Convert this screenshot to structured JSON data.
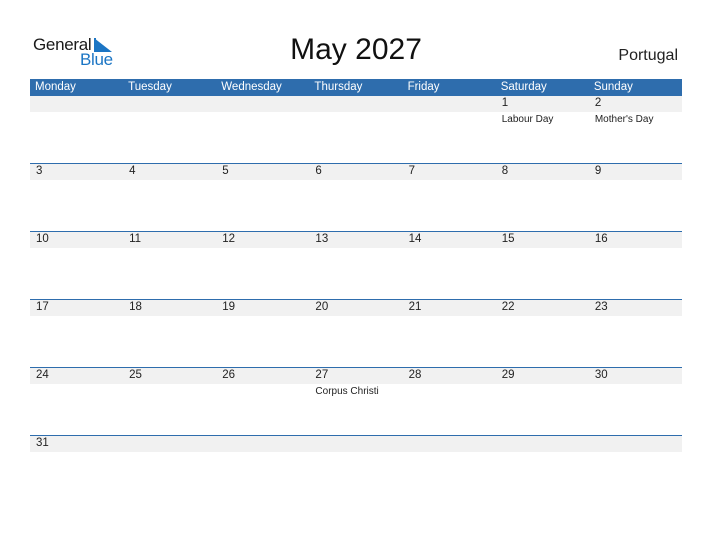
{
  "logo": {
    "line1": "General",
    "line2": "Blue"
  },
  "title": "May 2027",
  "country": "Portugal",
  "colors": {
    "header": "#2e6dad",
    "brand": "#1b75c4",
    "band": "#f1f1f1"
  },
  "weekdays": [
    "Monday",
    "Tuesday",
    "Wednesday",
    "Thursday",
    "Friday",
    "Saturday",
    "Sunday"
  ],
  "weeks": [
    [
      {
        "d": "",
        "h": ""
      },
      {
        "d": "",
        "h": ""
      },
      {
        "d": "",
        "h": ""
      },
      {
        "d": "",
        "h": ""
      },
      {
        "d": "",
        "h": ""
      },
      {
        "d": "1",
        "h": "Labour Day"
      },
      {
        "d": "2",
        "h": "Mother's Day"
      }
    ],
    [
      {
        "d": "3",
        "h": ""
      },
      {
        "d": "4",
        "h": ""
      },
      {
        "d": "5",
        "h": ""
      },
      {
        "d": "6",
        "h": ""
      },
      {
        "d": "7",
        "h": ""
      },
      {
        "d": "8",
        "h": ""
      },
      {
        "d": "9",
        "h": ""
      }
    ],
    [
      {
        "d": "10",
        "h": ""
      },
      {
        "d": "11",
        "h": ""
      },
      {
        "d": "12",
        "h": ""
      },
      {
        "d": "13",
        "h": ""
      },
      {
        "d": "14",
        "h": ""
      },
      {
        "d": "15",
        "h": ""
      },
      {
        "d": "16",
        "h": ""
      }
    ],
    [
      {
        "d": "17",
        "h": ""
      },
      {
        "d": "18",
        "h": ""
      },
      {
        "d": "19",
        "h": ""
      },
      {
        "d": "20",
        "h": ""
      },
      {
        "d": "21",
        "h": ""
      },
      {
        "d": "22",
        "h": ""
      },
      {
        "d": "23",
        "h": ""
      }
    ],
    [
      {
        "d": "24",
        "h": ""
      },
      {
        "d": "25",
        "h": ""
      },
      {
        "d": "26",
        "h": ""
      },
      {
        "d": "27",
        "h": "Corpus Christi"
      },
      {
        "d": "28",
        "h": ""
      },
      {
        "d": "29",
        "h": ""
      },
      {
        "d": "30",
        "h": ""
      }
    ],
    [
      {
        "d": "31",
        "h": ""
      },
      {
        "d": "",
        "h": ""
      },
      {
        "d": "",
        "h": ""
      },
      {
        "d": "",
        "h": ""
      },
      {
        "d": "",
        "h": ""
      },
      {
        "d": "",
        "h": ""
      },
      {
        "d": "",
        "h": ""
      }
    ]
  ]
}
